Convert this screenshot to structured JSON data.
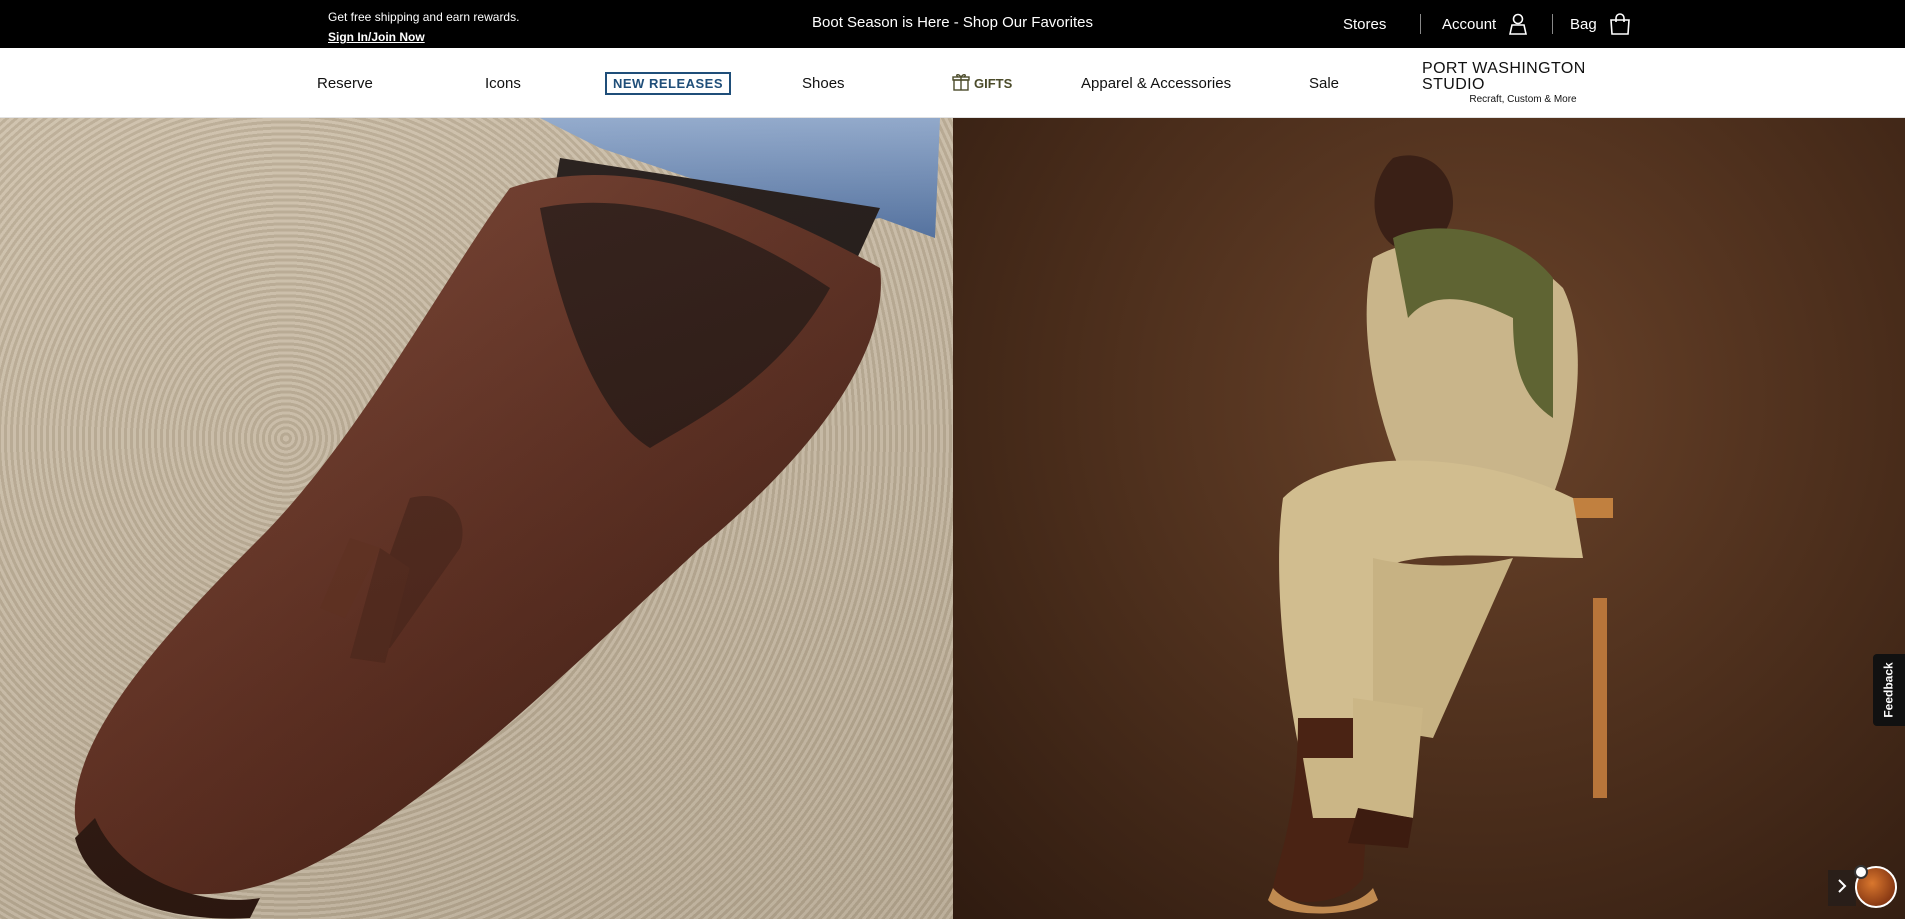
{
  "topbar": {
    "promo_line1": "Get free shipping and earn rewards.",
    "promo_line2": "Sign In/Join Now",
    "announcement": "Boot Season is Here - Shop Our Favorites",
    "stores": "Stores",
    "account": "Account",
    "bag": "Bag"
  },
  "nav": {
    "reserve": "Reserve",
    "icons": "Icons",
    "new_releases": "NEW RELEASES",
    "shoes": "Shoes",
    "gifts": "GIFTS",
    "apparel": "Apparel & Accessories",
    "sale": "Sale",
    "studio_title": "PORT WASHINGTON STUDIO",
    "studio_subtitle": "Recraft, Custom & More"
  },
  "feedback": "Feedback",
  "colors": {
    "topbar_bg": "#000000",
    "new_releases_accent": "#1f4e79",
    "gifts_color": "#4b4b2a"
  },
  "icons": {
    "account": "user-icon",
    "bag": "shopping-bag-icon",
    "gifts": "gift-icon",
    "next": "chevron-right-icon"
  }
}
